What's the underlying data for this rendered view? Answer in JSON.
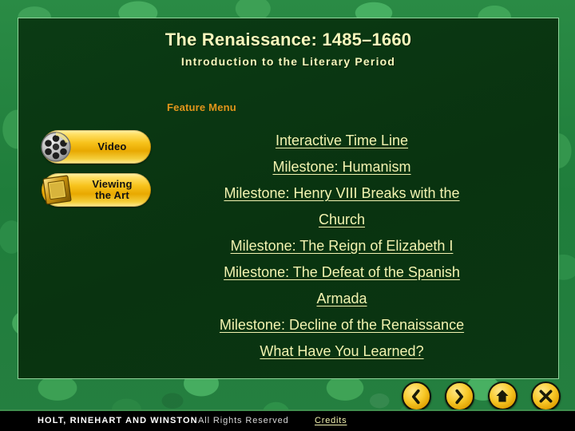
{
  "slide": {
    "title": "The Renaissance: 1485–1660",
    "subtitle": "Introduction to the Literary Period",
    "feature_menu_heading": "Feature Menu",
    "accent_title_color": "#f7f7bc",
    "accent_heading_color": "#e2951b",
    "link_color": "#f3f3b0",
    "panel_color": "#093310",
    "background_color": "#1d7a3a",
    "gold_color": "#f7c21b"
  },
  "media_buttons": [
    {
      "label_line1": "Video",
      "label_line2": "",
      "icon": "film-reel-icon"
    },
    {
      "label_line1": "Viewing",
      "label_line2": "the Art",
      "icon": "picture-frame-icon"
    }
  ],
  "menu_links": [
    {
      "text": "Interactive Time Line",
      "indent": 0
    },
    {
      "text": "Milestone: Humanism",
      "indent": 1
    },
    {
      "text": "Milestone: Henry VIII Breaks with the Church",
      "indent": 1
    },
    {
      "text": "Milestone: The Reign of Elizabeth I",
      "indent": 1
    },
    {
      "text": "Milestone: The Defeat of the Spanish Armada",
      "indent": 1
    },
    {
      "text": "Milestone: Decline of the Renaissance",
      "indent": 1
    },
    {
      "text": "What Have You Learned?",
      "indent": 0
    }
  ],
  "menu_rows": [
    {
      "text": "Interactive Time Line"
    },
    {
      "text": "Milestone: Humanism"
    },
    {
      "text": "Milestone: Henry VIII Breaks with the"
    },
    {
      "text": "Church"
    },
    {
      "text": "Milestone: The Reign of Elizabeth I"
    },
    {
      "text": "Milestone: The Defeat of the Spanish"
    },
    {
      "text": "Armada"
    },
    {
      "text": "Milestone: Decline of the Renaissance"
    },
    {
      "text": "What Have You Learned?"
    }
  ],
  "navigation": [
    {
      "label": "Previous",
      "icon": "chevron-left-icon"
    },
    {
      "label": "Next",
      "icon": "chevron-right-icon"
    },
    {
      "label": "Collection Menu",
      "icon": "home-icon"
    },
    {
      "label": "Exit",
      "icon": "close-x-icon"
    }
  ],
  "footer": {
    "publisher": "HOLT, RINEHART AND WINSTON",
    "rights": "All Rights Reserved",
    "credits": "Credits"
  }
}
